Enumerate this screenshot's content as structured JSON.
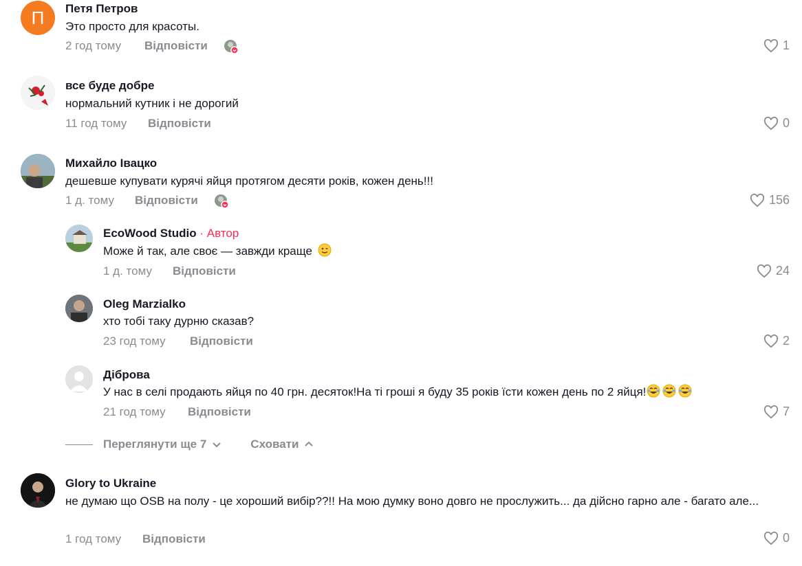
{
  "comments": [
    {
      "avatar_letter": "П",
      "avatar_color": "#f47b20",
      "name": "Петя Петров",
      "text": "Это просто для красоты.",
      "time": "2 год тому",
      "reply": "Відповісти",
      "likes": "1",
      "creator_liked": true
    },
    {
      "name": "все буде добре",
      "text": "нормальний кутник і не дорогий",
      "time": "11 год тому",
      "reply": "Відповісти",
      "likes": "0",
      "creator_liked": false
    },
    {
      "name": "Михайло Івацко",
      "text": "дешевше купувати курячі яйця протягом десяти років, кожен день!!!",
      "time": "1 д. тому",
      "reply": "Відповісти",
      "likes": "156",
      "creator_liked": true
    },
    {
      "name": "EcoWood Studio",
      "author_tag": " · Автор",
      "text": "Може й так, але своє — завжди краще",
      "time": "1 д. тому",
      "reply": "Відповісти",
      "likes": "24",
      "creator_liked": false
    },
    {
      "name": "Oleg Marzialko",
      "text": "хто тобі таку дурню сказав?",
      "time": "23 год тому",
      "reply": "Відповісти",
      "likes": "2",
      "creator_liked": false
    },
    {
      "name": "Діброва",
      "text": "У нас в селі продають яйця по 40 грн. десяток!На ті гроші я буду 35 років їсти кожен день по 2 яйця!",
      "time": "21 год тому",
      "reply": "Відповісти",
      "likes": "7",
      "creator_liked": false
    },
    {
      "name": "Glory to Ukraine",
      "text": "не думаю що OSB на полу - це хороший вибір??!! На мою думку воно довго не прослужить... да дійсно гарно але - багато але...",
      "time": "1 год тому",
      "reply": "Відповісти",
      "likes": "0",
      "creator_liked": false
    }
  ],
  "replies_controls": {
    "view_more": "Переглянути ще 7",
    "hide": "Сховати"
  },
  "icons": {
    "like": "heart-outline-icon",
    "wink": "winking-face-emoji",
    "laugh": "tears-of-joy-emoji",
    "chevron_down": "chevron-down-icon",
    "chevron_up": "chevron-up-icon"
  },
  "colors": {
    "accent": "#fe2c55",
    "muted": "#8a8b91",
    "text": "#161823"
  }
}
